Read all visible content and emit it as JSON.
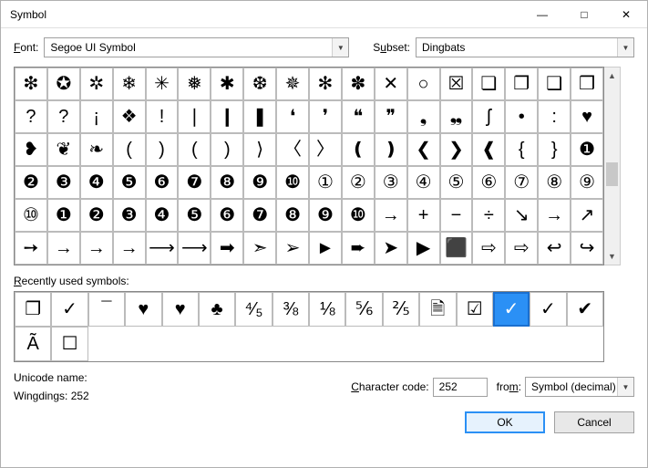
{
  "title": "Symbol",
  "labels": {
    "font": "Font:",
    "subset": "Subset:",
    "recent": "Recently used symbols:",
    "unicode_name": "Unicode name:",
    "wingdings": "Wingdings: 252",
    "char_code": "Character code:",
    "from": "from:"
  },
  "font_value": "Segoe UI Symbol",
  "subset_value": "Dingbats",
  "char_code_value": "252",
  "from_value": "Symbol (decimal)",
  "buttons": {
    "ok": "OK",
    "cancel": "Cancel"
  },
  "grid": [
    [
      "❇",
      "✪",
      "✲",
      "❄",
      "✳",
      "❅",
      "✱",
      "❆",
      "✵",
      "✻",
      "✽",
      "✕",
      "○",
      "☒",
      "❏",
      "❐",
      "❑",
      "❒"
    ],
    [
      "?",
      "?",
      "¡",
      "❖",
      "!",
      "❘",
      "❙",
      "❚",
      "❛",
      "❜",
      "❝",
      "❞",
      "❟",
      "❠",
      "ʃ",
      "•",
      ":",
      "♥"
    ],
    [
      "❥",
      "❦",
      "❧",
      "(",
      ")",
      "(",
      ")",
      "⟩",
      "〈",
      "〉",
      "❪",
      "❫",
      "❮",
      "❯",
      "❰",
      "{",
      "}",
      "❶"
    ],
    [
      "❷",
      "❸",
      "❹",
      "❺",
      "❻",
      "❼",
      "❽",
      "❾",
      "❿",
      "①",
      "②",
      "③",
      "④",
      "⑤",
      "⑥",
      "⑦",
      "⑧",
      "⑨"
    ],
    [
      "⑩",
      "❶",
      "❷",
      "❸",
      "❹",
      "❺",
      "❻",
      "❼",
      "❽",
      "❾",
      "❿",
      "→",
      "+",
      "−",
      "÷",
      "↘",
      "→",
      "↗"
    ],
    [
      "➙",
      "→",
      "→",
      "→",
      "⟶",
      "⟶",
      "➡",
      "➣",
      "➢",
      "►",
      "➨",
      "➤",
      "▶",
      "⬛",
      "⇨",
      "⇨",
      "↩",
      "↪"
    ]
  ],
  "recent": [
    "❐",
    "✓",
    "¯",
    "♥",
    "♥",
    "♣",
    "⁴⁄₅",
    "⅜",
    "⅛",
    "⅚",
    "⅖",
    "🗎",
    "☑",
    "✓",
    "✓",
    "✔",
    "Ã",
    "☐"
  ],
  "recent_selected": 13
}
